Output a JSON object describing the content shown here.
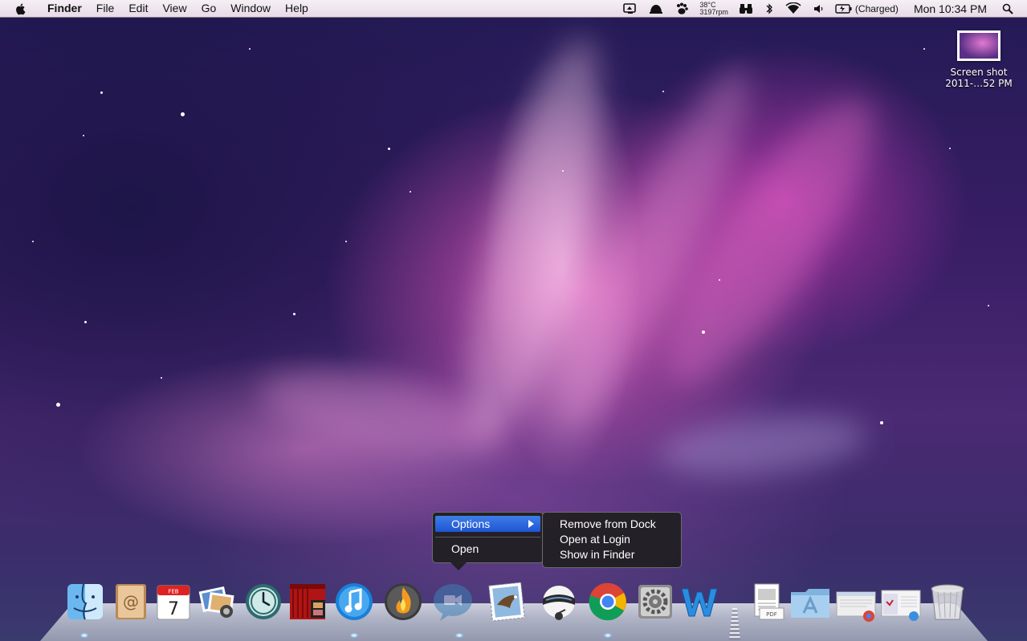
{
  "menubar": {
    "apple_icon": "apple-logo-icon",
    "items": [
      "Finder",
      "File",
      "Edit",
      "View",
      "Go",
      "Window",
      "Help"
    ],
    "status": {
      "temperature": "38°C",
      "fan_speed": "3197rpm",
      "battery_text": "(Charged)",
      "clock": "Mon 10:34 PM"
    }
  },
  "desktop": {
    "icon_label_line1": "Screen shot",
    "icon_label_line2": "2011-…52 PM"
  },
  "context_menu": {
    "options_label": "Options",
    "open_label": "Open",
    "submenu": [
      "Remove from Dock",
      "Open at Login",
      "Show in Finder"
    ]
  },
  "dock": {
    "apps": [
      "finder-icon",
      "address-book-icon",
      "ical-icon",
      "iphoto-icon",
      "time-machine-icon",
      "front-row-icon",
      "itunes-icon",
      "firewall-app-icon",
      "facetime-icon",
      "mail-icon",
      "messenger-icon",
      "chrome-icon",
      "system-preferences-icon",
      "word-icon"
    ],
    "calendar_month": "FEB",
    "calendar_day": "7",
    "stacks": [
      "documents-stack-icon",
      "applications-folder-icon",
      "downloads-stack-icon",
      "screenshots-stack-icon",
      "trash-icon"
    ]
  },
  "colors": {
    "menu_highlight": "#2d66dd",
    "menubar": "#ece3ec"
  }
}
